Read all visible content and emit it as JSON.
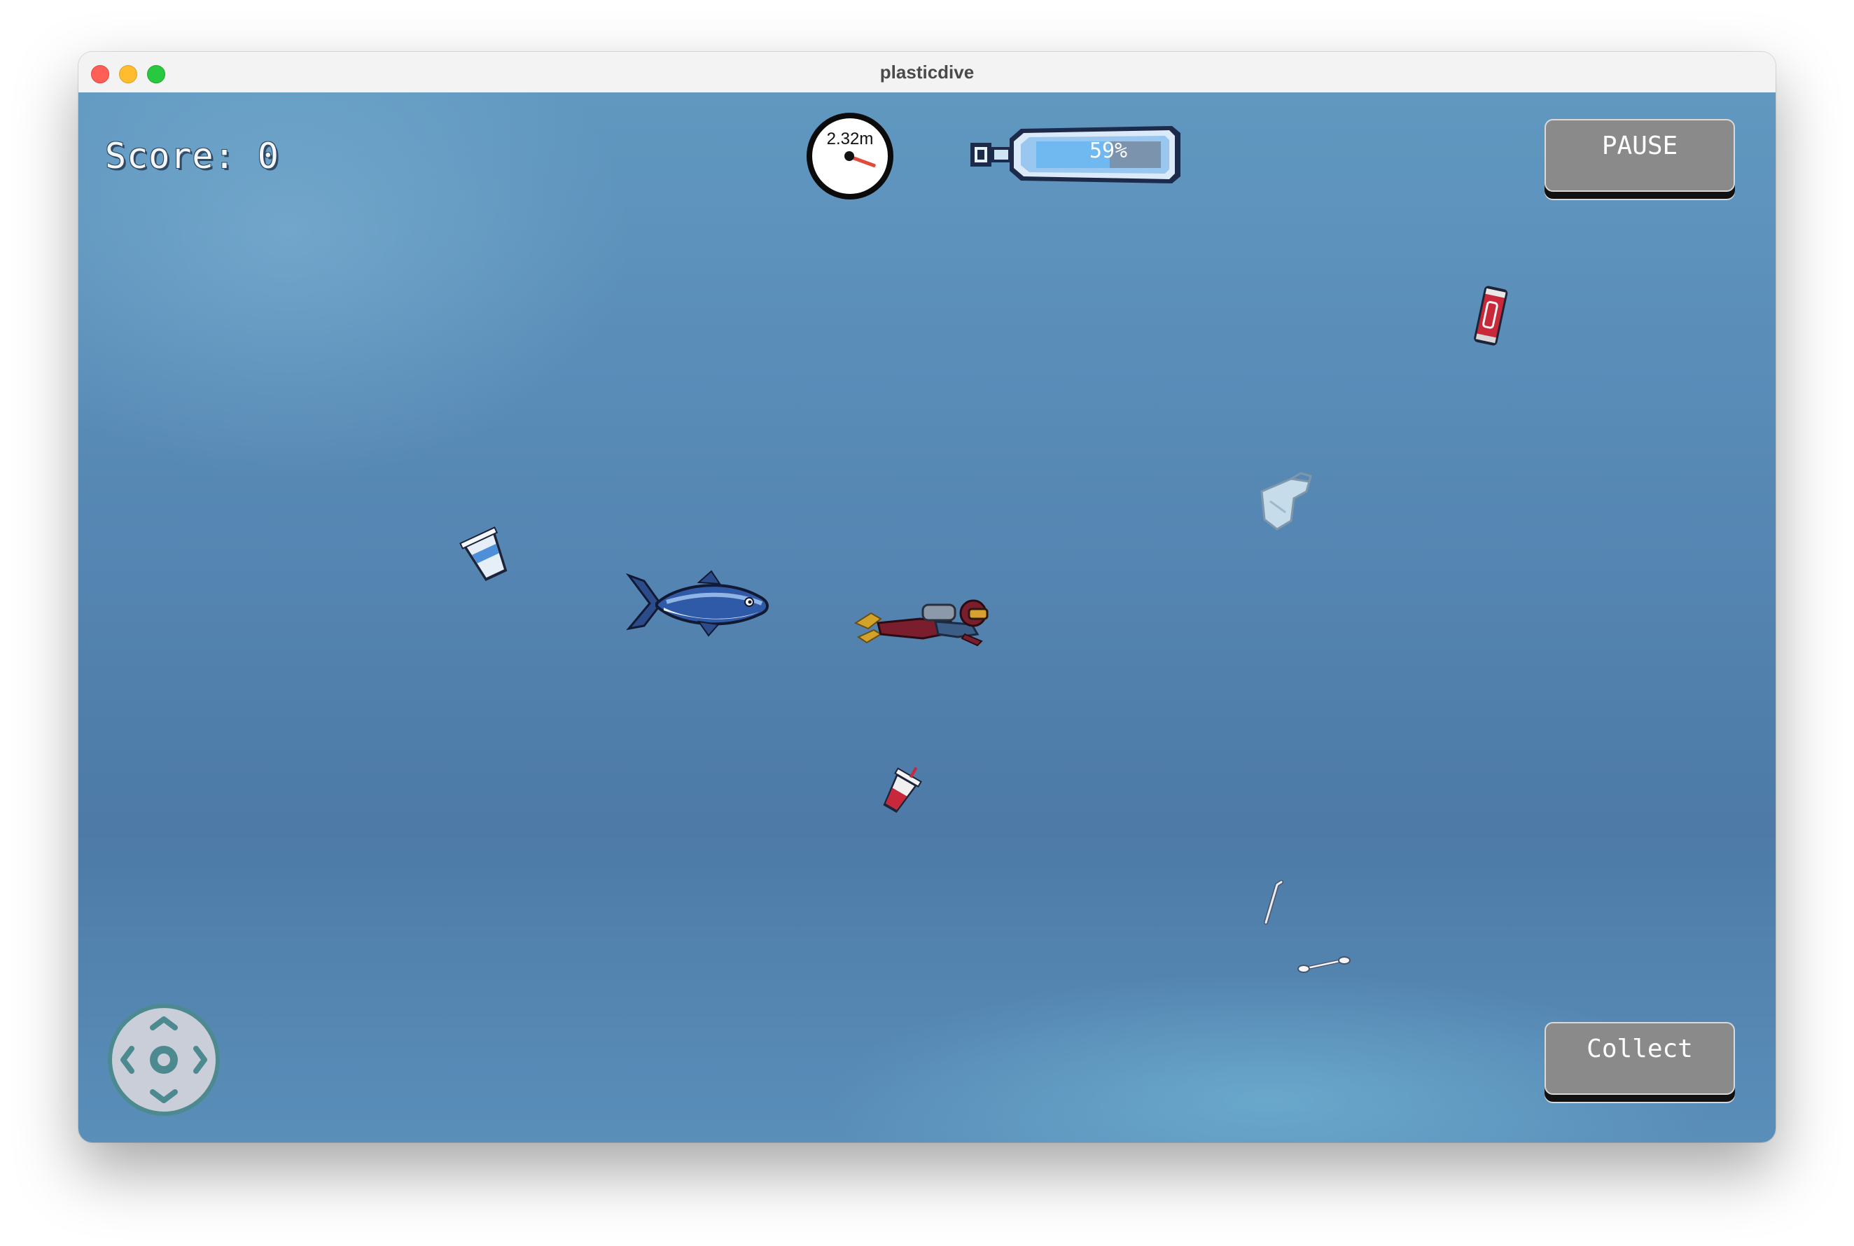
{
  "window": {
    "title": "plasticdive"
  },
  "hud": {
    "score_text": "Score: 0",
    "depth_text": "2.32m",
    "oxygen_text": "59%",
    "oxygen_level": 0.59
  },
  "buttons": {
    "pause_label": "PAUSE",
    "collect_label": "Collect"
  },
  "colors": {
    "water": "#5585b2",
    "button": "#8a8a8a",
    "oxygen_fill": "#6fb8f0",
    "dpad_accent": "#4d8a8f"
  },
  "icons": [
    "depth-gauge-icon",
    "oxygen-tank-icon",
    "dpad-icon",
    "diver-icon",
    "tuna-fish-icon",
    "plastic-cup-icon",
    "soda-can-icon",
    "plastic-bag-icon",
    "drink-cup-icon",
    "straw-icon",
    "cotton-swab-icon"
  ]
}
